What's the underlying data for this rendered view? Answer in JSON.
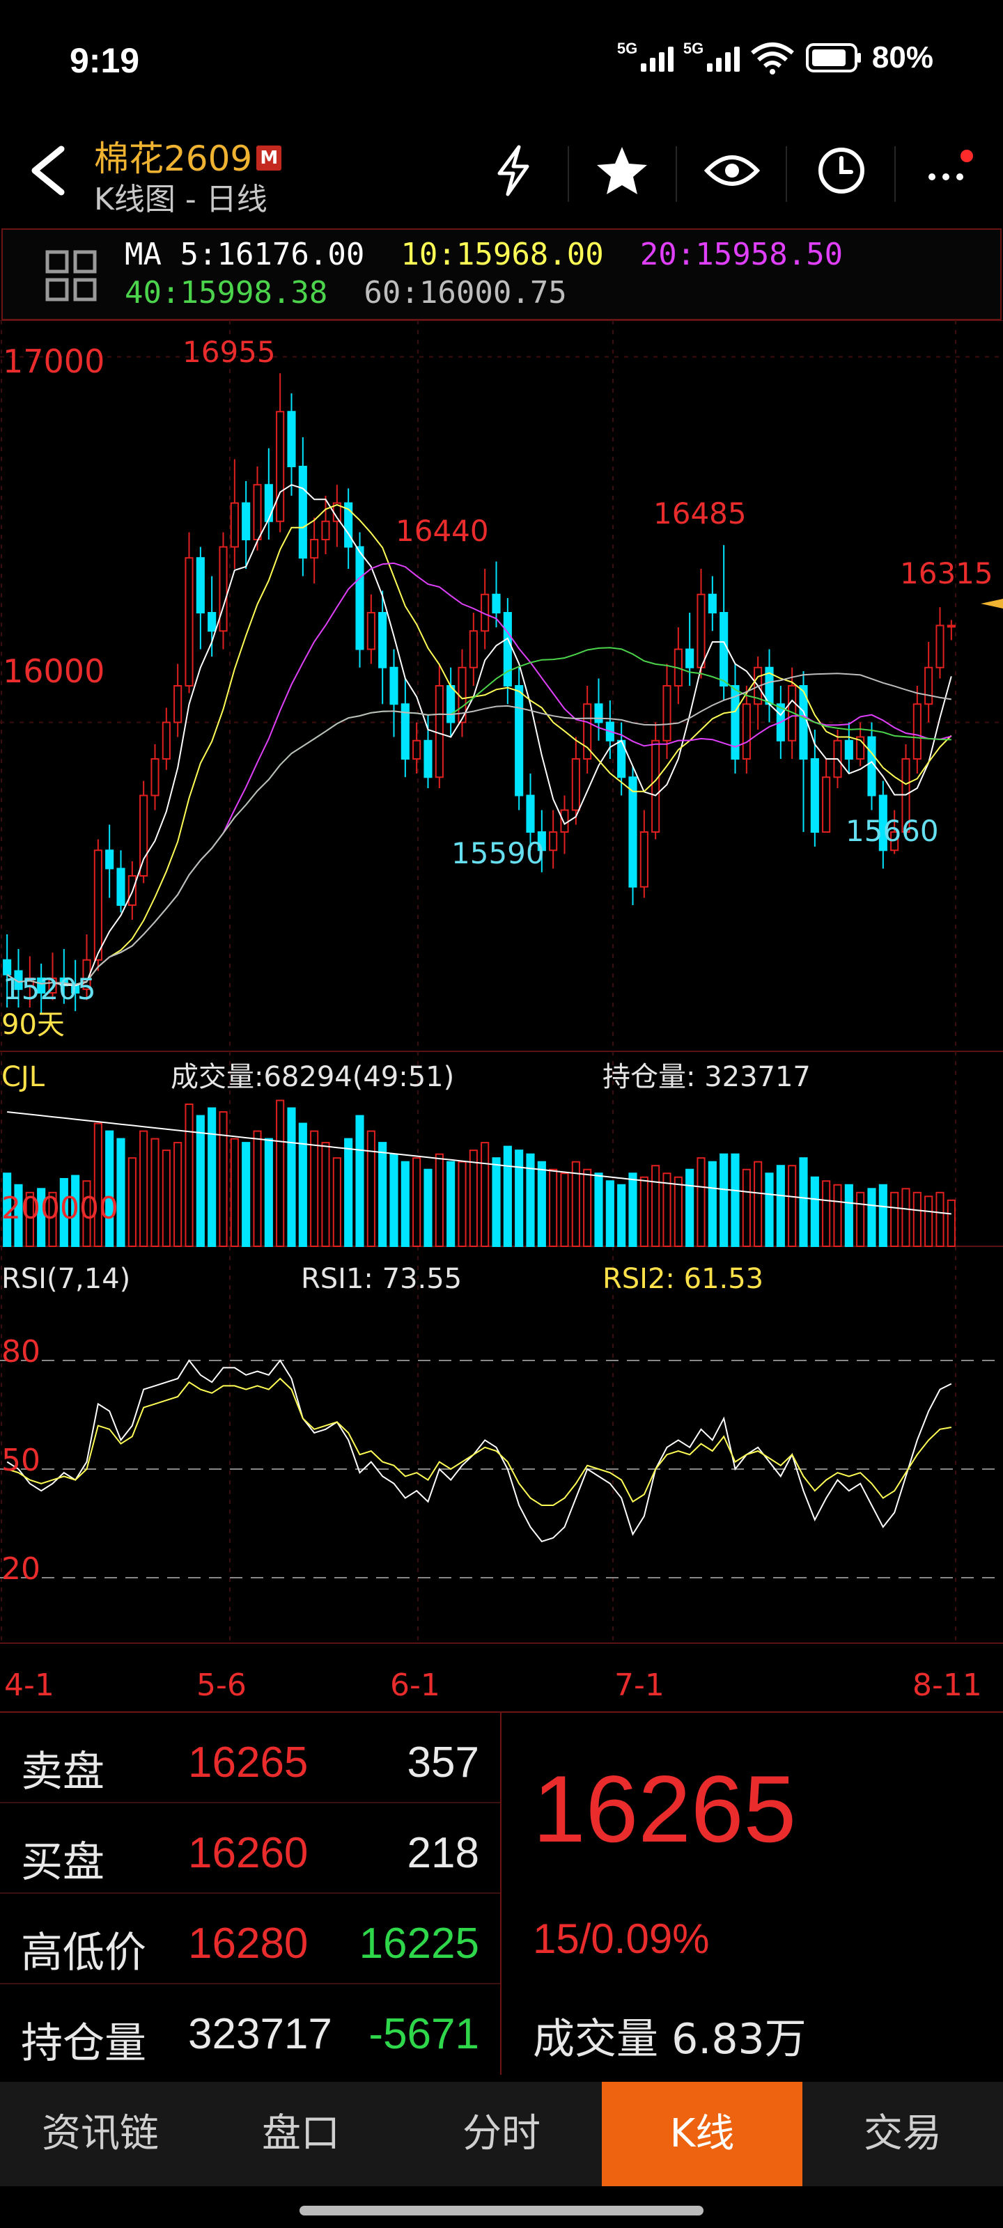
{
  "status_bar": {
    "time": "9:19",
    "network1": "5G",
    "network2": "5G",
    "battery": "80%"
  },
  "header": {
    "title": "棉花2609",
    "badge": "M",
    "subtitle": "K线图 - 日线",
    "icons": [
      "back-icon",
      "lightning-icon",
      "star-icon",
      "eye-icon",
      "clock-icon",
      "more-icon"
    ]
  },
  "ma": {
    "ma5": "MA  5:16176.00",
    "ma10": "10:15968.00",
    "ma20": "20:15958.50",
    "ma40": "40:15998.38",
    "ma60": "60:16000.75"
  },
  "colors": {
    "up": "#e0201f",
    "down": "#00e5ff",
    "ma5": "#ffffff",
    "ma10": "#ffff55",
    "ma20": "#e040fb",
    "ma40": "#4cd44c",
    "ma60": "#bdbdbd",
    "accent": "#ee6310"
  },
  "main_chart": {
    "price_labels": [
      "17000",
      "16000"
    ],
    "annotations": {
      "high": "16955",
      "peak2": "16440",
      "peak3": "16485",
      "peak4": "16315",
      "low1": "15205",
      "low2": "15590",
      "low3": "15660"
    },
    "period": "90天"
  },
  "volume_panel": {
    "title": "CJL",
    "volume_text": "成交量:68294(49:51)",
    "oi_text": "持仓量: 323717",
    "axis_label": "200000"
  },
  "rsi_panel": {
    "title": "RSI(7,14)",
    "rsi1": "RSI1: 73.55",
    "rsi2": "RSI2: 61.53",
    "levels": [
      "80",
      "50",
      "20"
    ]
  },
  "x_axis": [
    "4-1",
    "5-6",
    "6-1",
    "7-1",
    "8-11"
  ],
  "chart_data": {
    "type": "candlestick",
    "title": "棉花2609",
    "ylim": [
      15100,
      17100
    ],
    "candles": [
      [
        15350,
        15310,
        15420,
        15220
      ],
      [
        15320,
        15270,
        15380,
        15220
      ],
      [
        15280,
        15300,
        15360,
        15220
      ],
      [
        15300,
        15260,
        15340,
        15205
      ],
      [
        15260,
        15300,
        15370,
        15240
      ],
      [
        15300,
        15280,
        15380,
        15230
      ],
      [
        15280,
        15260,
        15350,
        15210
      ],
      [
        15270,
        15350,
        15420,
        15240
      ],
      [
        15350,
        15650,
        15680,
        15320
      ],
      [
        15650,
        15600,
        15720,
        15520
      ],
      [
        15600,
        15500,
        15650,
        15480
      ],
      [
        15500,
        15580,
        15620,
        15460
      ],
      [
        15580,
        15800,
        15840,
        15560
      ],
      [
        15800,
        15900,
        15940,
        15760
      ],
      [
        15900,
        16000,
        16040,
        15870
      ],
      [
        16000,
        16100,
        16160,
        15960
      ],
      [
        16100,
        16450,
        16520,
        16080
      ],
      [
        16450,
        16300,
        16480,
        16200
      ],
      [
        16300,
        16250,
        16400,
        16180
      ],
      [
        16250,
        16480,
        16520,
        16200
      ],
      [
        16480,
        16600,
        16720,
        16420
      ],
      [
        16600,
        16500,
        16660,
        16420
      ],
      [
        16500,
        16650,
        16700,
        16470
      ],
      [
        16650,
        16550,
        16750,
        16500
      ],
      [
        16550,
        16850,
        16955,
        16520
      ],
      [
        16850,
        16700,
        16900,
        16620
      ],
      [
        16700,
        16450,
        16780,
        16400
      ],
      [
        16450,
        16500,
        16560,
        16380
      ],
      [
        16500,
        16550,
        16620,
        16460
      ],
      [
        16550,
        16600,
        16650,
        16480
      ],
      [
        16600,
        16480,
        16640,
        16420
      ],
      [
        16480,
        16200,
        16520,
        16150
      ],
      [
        16200,
        16300,
        16350,
        16160
      ],
      [
        16300,
        16150,
        16360,
        16050
      ],
      [
        16150,
        16050,
        16200,
        15960
      ],
      [
        16050,
        15900,
        16120,
        15850
      ],
      [
        15900,
        15950,
        16000,
        15860
      ],
      [
        15950,
        15850,
        16020,
        15820
      ],
      [
        15850,
        16100,
        16160,
        15820
      ],
      [
        16100,
        16000,
        16150,
        15960
      ],
      [
        16000,
        16150,
        16200,
        15960
      ],
      [
        16150,
        16250,
        16300,
        16100
      ],
      [
        16250,
        16350,
        16420,
        16200
      ],
      [
        16350,
        16300,
        16440,
        16260
      ],
      [
        16300,
        16100,
        16340,
        16050
      ],
      [
        16100,
        15800,
        16150,
        15760
      ],
      [
        15800,
        15700,
        15860,
        15650
      ],
      [
        15700,
        15650,
        15760,
        15590
      ],
      [
        15650,
        15700,
        15760,
        15600
      ],
      [
        15700,
        15760,
        15800,
        15640
      ],
      [
        15760,
        15900,
        15960,
        15720
      ],
      [
        15900,
        16050,
        16100,
        15860
      ],
      [
        16050,
        16000,
        16120,
        15950
      ],
      [
        16000,
        15950,
        16060,
        15900
      ],
      [
        15950,
        15850,
        16000,
        15800
      ],
      [
        15850,
        15550,
        15880,
        15500
      ],
      [
        15550,
        15700,
        15760,
        15520
      ],
      [
        15700,
        15950,
        16000,
        15680
      ],
      [
        15950,
        16100,
        16160,
        15900
      ],
      [
        16100,
        16200,
        16260,
        16050
      ],
      [
        16200,
        16150,
        16300,
        16100
      ],
      [
        16150,
        16350,
        16420,
        16120
      ],
      [
        16350,
        16300,
        16400,
        16250
      ],
      [
        16300,
        16100,
        16485,
        16060
      ],
      [
        16100,
        15900,
        16160,
        15860
      ],
      [
        15900,
        16050,
        16100,
        15860
      ],
      [
        16050,
        16150,
        16180,
        15980
      ],
      [
        16150,
        16050,
        16200,
        16000
      ],
      [
        16050,
        15950,
        16100,
        15900
      ],
      [
        15950,
        16100,
        16150,
        15900
      ],
      [
        16100,
        15900,
        16140,
        15700
      ],
      [
        15900,
        15700,
        15980,
        15660
      ],
      [
        15700,
        15850,
        15900,
        15700
      ],
      [
        15850,
        15950,
        15980,
        15820
      ],
      [
        15950,
        15900,
        16000,
        15860
      ],
      [
        15900,
        15960,
        16000,
        15880
      ],
      [
        15960,
        15800,
        16000,
        15760
      ],
      [
        15800,
        15650,
        15840,
        15600
      ],
      [
        15650,
        15700,
        15760,
        15640
      ],
      [
        15700,
        15900,
        15940,
        15680
      ],
      [
        15900,
        16050,
        16100,
        15860
      ],
      [
        16050,
        16150,
        16220,
        16000
      ],
      [
        16150,
        16265,
        16315,
        16120
      ],
      [
        16265,
        16265,
        16280,
        16225
      ]
    ],
    "volume": [
      95,
      80,
      70,
      75,
      70,
      88,
      92,
      85,
      160,
      150,
      140,
      115,
      150,
      140,
      125,
      135,
      185,
      170,
      180,
      175,
      140,
      135,
      150,
      140,
      190,
      180,
      160,
      150,
      135,
      115,
      140,
      170,
      150,
      135,
      120,
      110,
      115,
      100,
      120,
      110,
      110,
      125,
      135,
      115,
      130,
      125,
      120,
      110,
      100,
      95,
      110,
      100,
      95,
      85,
      80,
      95,
      90,
      105,
      95,
      90,
      100,
      115,
      110,
      120,
      120,
      100,
      110,
      95,
      105,
      105,
      115,
      90,
      85,
      80,
      80,
      70,
      75,
      80,
      70,
      75,
      70,
      65,
      70,
      60
    ],
    "rsi1": [
      52,
      50,
      46,
      44,
      46,
      49,
      47,
      52,
      68,
      66,
      58,
      62,
      72,
      73,
      74,
      75,
      80,
      76,
      74,
      78,
      78,
      76,
      77,
      76,
      80,
      75,
      64,
      60,
      61,
      63,
      58,
      49,
      52,
      48,
      46,
      42,
      44,
      41,
      50,
      47,
      51,
      54,
      58,
      56,
      50,
      40,
      34,
      30,
      31,
      34,
      42,
      50,
      48,
      46,
      42,
      32,
      37,
      50,
      56,
      58,
      56,
      61,
      58,
      64,
      50,
      54,
      56,
      52,
      48,
      54,
      44,
      36,
      42,
      47,
      44,
      46,
      40,
      34,
      38,
      48,
      58,
      66,
      72,
      73.55
    ],
    "rsi2": [
      50,
      49,
      47,
      46,
      47,
      48,
      47,
      50,
      62,
      61,
      57,
      59,
      67,
      68,
      69,
      70,
      74,
      72,
      71,
      73,
      73,
      72,
      73,
      72,
      75,
      72,
      64,
      61,
      62,
      63,
      60,
      54,
      55,
      52,
      51,
      48,
      49,
      47,
      52,
      50,
      52,
      54,
      56,
      55,
      52,
      46,
      42,
      40,
      40,
      42,
      46,
      51,
      50,
      49,
      47,
      41,
      43,
      50,
      54,
      55,
      54,
      57,
      55,
      59,
      52,
      54,
      55,
      53,
      51,
      54,
      48,
      44,
      47,
      49,
      48,
      49,
      46,
      42,
      44,
      49,
      54,
      58,
      61,
      61.53
    ]
  },
  "quote": {
    "ask_label": "卖盘",
    "ask_price": "16265",
    "ask_qty": "357",
    "bid_label": "买盘",
    "bid_price": "16260",
    "bid_qty": "218",
    "hl_label": "高低价",
    "high": "16280",
    "low": "16225",
    "oi_label": "持仓量",
    "oi": "323717",
    "oi_change": "-5671",
    "last_price": "16265",
    "change": "15/0.09%",
    "vol_label": "成交量",
    "vol_value": "6.83万"
  },
  "tabs": [
    "资讯链",
    "盘口",
    "分时",
    "K线",
    "交易"
  ],
  "active_tab": "K线"
}
